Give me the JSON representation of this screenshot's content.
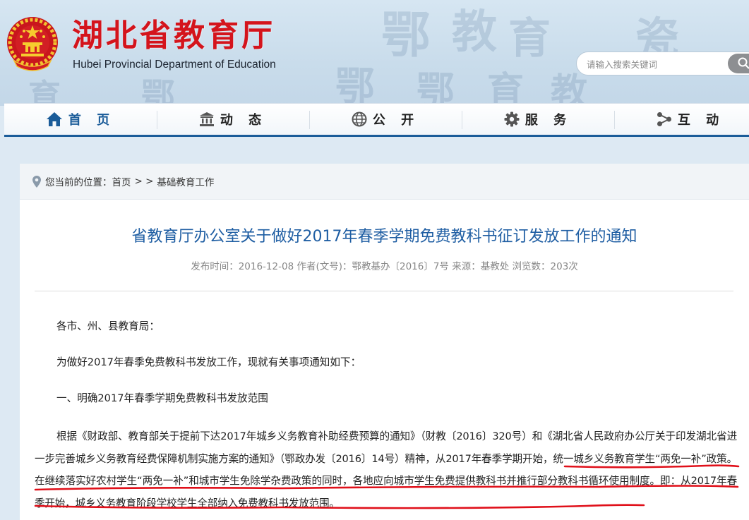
{
  "header": {
    "title": "湖北省教育厅",
    "subtitle": "Hubei Provincial Department of Education"
  },
  "search": {
    "placeholder": "请输入搜索关键词"
  },
  "nav": {
    "items": [
      {
        "label": "首 页",
        "icon": "home-icon"
      },
      {
        "label": "动 态",
        "icon": "building-icon"
      },
      {
        "label": "公 开",
        "icon": "globe-icon"
      },
      {
        "label": "服 务",
        "icon": "gear-icon"
      },
      {
        "label": "互 动",
        "icon": "share-icon"
      }
    ]
  },
  "breadcrumb": {
    "prefix": "您当前的位置：",
    "home": "首页",
    "sep": "> >",
    "current": "基础教育工作"
  },
  "article": {
    "title": "省教育厅办公室关于做好2017年春季学期免费教科书征订发放工作的通知",
    "meta": "发布时间：2016-12-08 作者(文号)：鄂教基办〔2016〕7号 来源：基教处 浏览数：203次",
    "greeting": "各市、州、县教育局：",
    "intro": "为做好2017年春季免费教科书发放工作，现就有关事项通知如下：",
    "section1": "一、明确2017年春季学期免费教科书发放范围",
    "body": "根据《财政部、教育部关于提前下达2017年城乡义务教育补助经费预算的通知》（财教〔2016〕320号）和《湖北省人民政府办公厅关于印发湖北省进一步完善城乡义务教育经费保障机制实施方案的通知》（鄂政办发〔2016〕14号）精神，从2017年春季学期开始，统一城乡义务教育学生“两免一补”政策。在继续落实好农村学生“两免一补”和城市学生免除学杂费政策的同时，各地应向城市学生免费提供教科书并推行部分教科书循环使用制度。即：从2017年春季开始，城乡义务教育阶段学校学生全部纳入免费教科书发放范围。"
  },
  "colors": {
    "brand_red": "#d4141c",
    "nav_blue": "#1b5c99",
    "title_blue": "#1f5ea3",
    "annotation_red": "#e0101a"
  }
}
